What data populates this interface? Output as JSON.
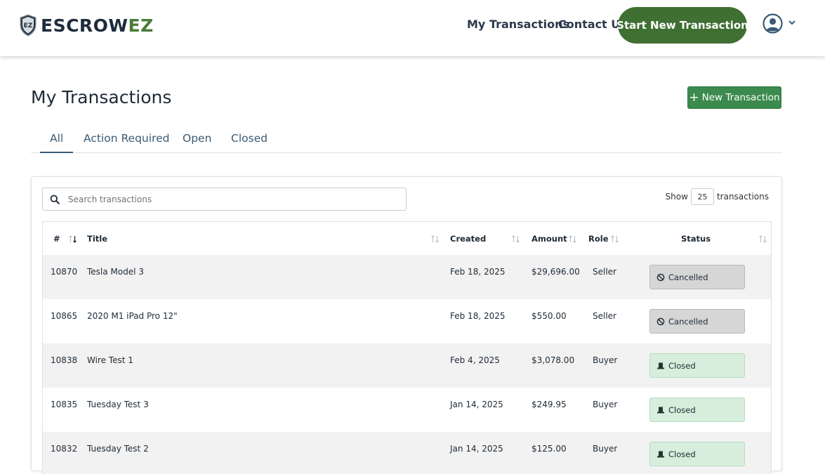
{
  "brand": {
    "logo_prefix": "ESCROW",
    "logo_suffix": "EZ",
    "shield_text": "EZ",
    "colors": {
      "navy": "#1e2c3c",
      "green": "#4a7c3a"
    }
  },
  "nav": {
    "links": [
      "My Transactions",
      "Contact Us"
    ],
    "cta_label": "Start New Transaction",
    "avatar_icon": "user-circle-icon",
    "menu_icon": "chevron-down-icon"
  },
  "page": {
    "title": "My Transactions",
    "new_button_label": "New Transaction",
    "new_button_icon": "plus-icon"
  },
  "tabs": [
    {
      "label": "All",
      "active": true
    },
    {
      "label": "Action Required",
      "active": false
    },
    {
      "label": "Open",
      "active": false
    },
    {
      "label": "Closed",
      "active": false
    }
  ],
  "search": {
    "placeholder": "Search transactions",
    "icon": "search-icon"
  },
  "page_size": {
    "prefix": "Show",
    "value": "25",
    "suffix": "transactions"
  },
  "table": {
    "columns": [
      "#",
      "Title",
      "Created",
      "Amount",
      "Role",
      "Status"
    ],
    "rows": [
      {
        "id": "10870",
        "title": "Tesla Model 3",
        "created": "Feb 18, 2025",
        "amount": "$29,696.00",
        "role": "Seller",
        "status": "Cancelled",
        "status_type": "cancelled"
      },
      {
        "id": "10865",
        "title": "2020 M1 iPad Pro 12\"",
        "created": "Feb 18, 2025",
        "amount": "$550.00",
        "role": "Seller",
        "status": "Cancelled",
        "status_type": "cancelled"
      },
      {
        "id": "10838",
        "title": "Wire Test 1",
        "created": "Feb 4, 2025",
        "amount": "$3,078.00",
        "role": "Buyer",
        "status": "Closed",
        "status_type": "closed"
      },
      {
        "id": "10835",
        "title": "Tuesday Test 3",
        "created": "Jan 14, 2025",
        "amount": "$249.95",
        "role": "Buyer",
        "status": "Closed",
        "status_type": "closed"
      },
      {
        "id": "10832",
        "title": "Tuesday Test 2",
        "created": "Jan 14, 2025",
        "amount": "$125.00",
        "role": "Buyer",
        "status": "Closed",
        "status_type": "closed"
      }
    ],
    "status_colors": {
      "cancelled": "#d6d6d6",
      "closed": "#d6eedb"
    }
  }
}
